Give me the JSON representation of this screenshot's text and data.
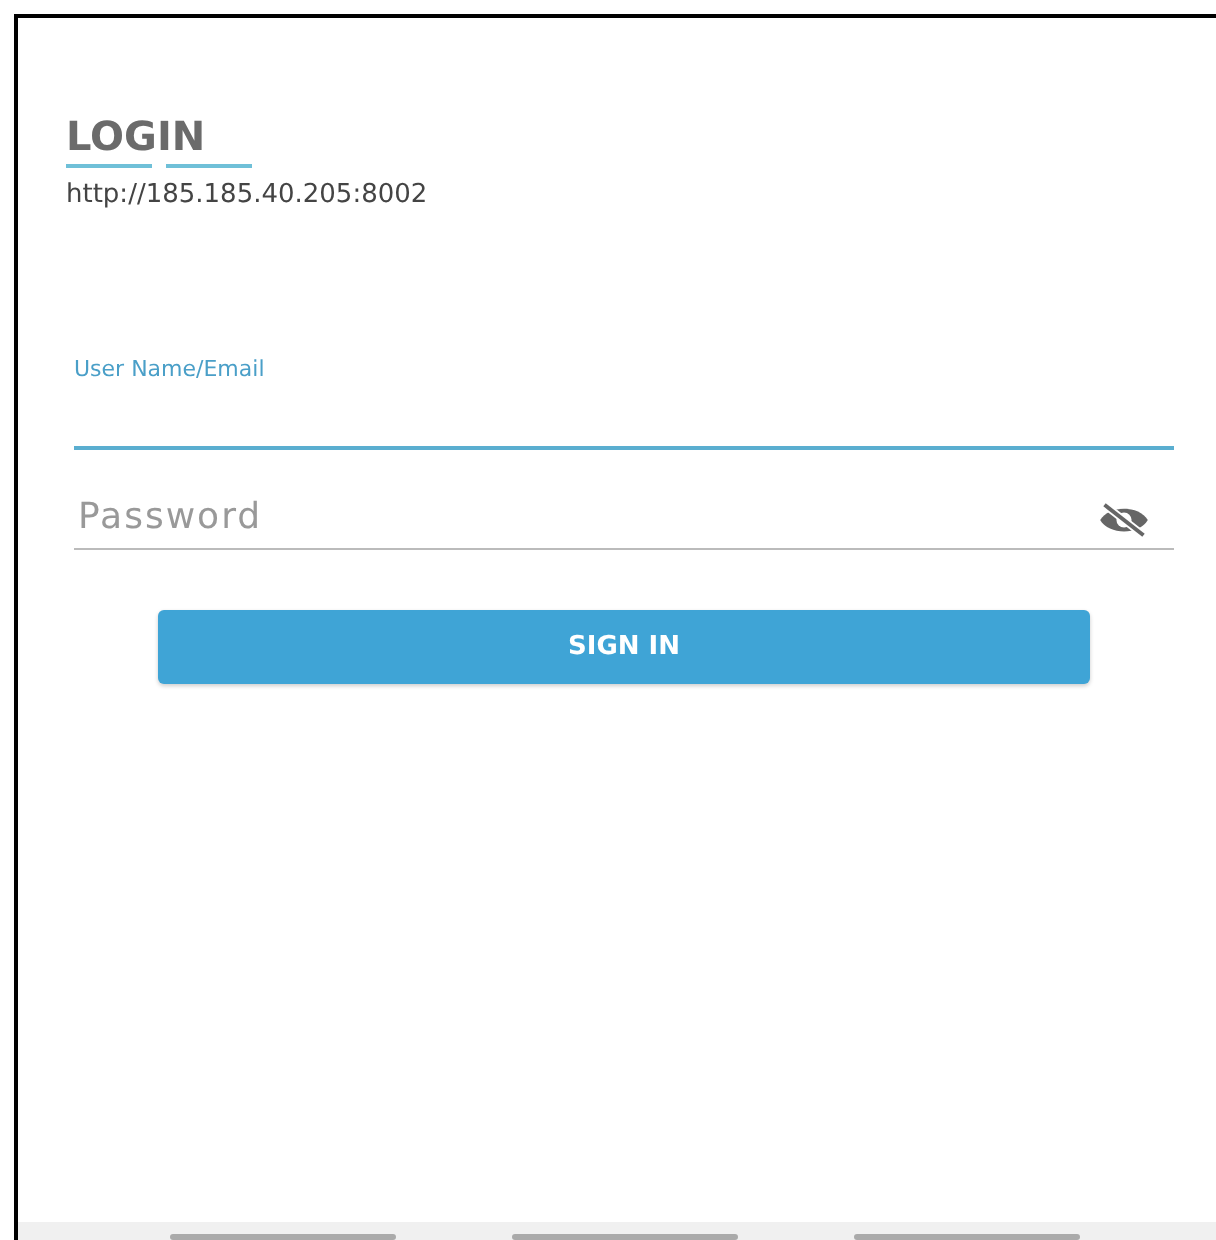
{
  "title": "LOGIN",
  "server_url": "http://185.185.40.205:8002",
  "fields": [
    {
      "kind": "text",
      "label": "User Name/Email",
      "focused": true
    },
    {
      "kind": "password",
      "placeholder": "Password",
      "focused": false,
      "revealed": false
    }
  ],
  "button": "SIGN IN"
}
